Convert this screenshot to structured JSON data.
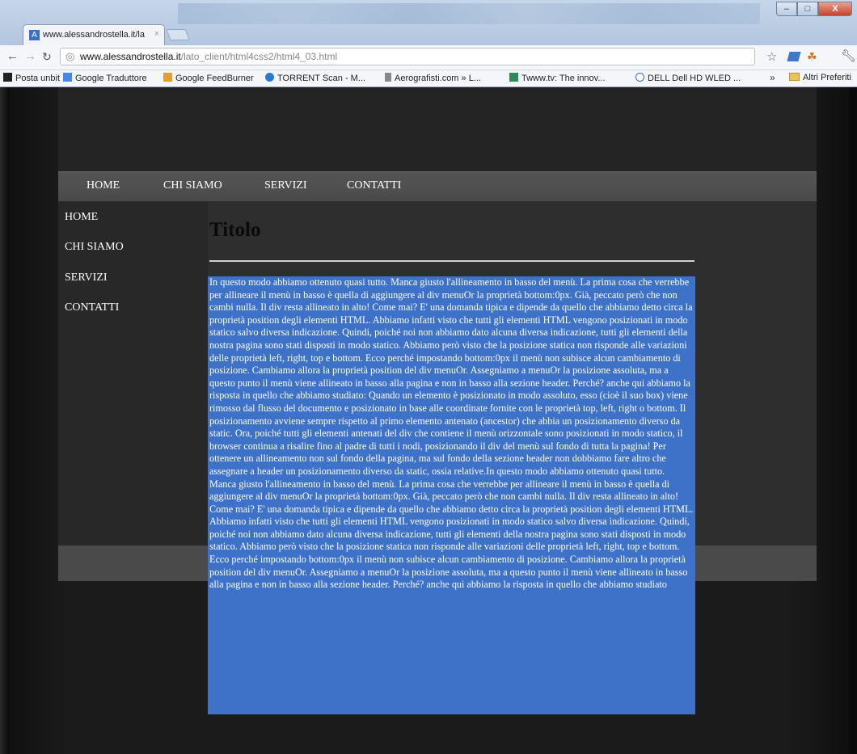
{
  "browser": {
    "tab_title": "www.alessandrostella.it/la",
    "tab_close": "×",
    "favicon_letter": "A",
    "url_host": "www.alessandrostella.it",
    "url_path": "/lato_client/html4css2/html4_03.html",
    "window_controls": {
      "minimize": "–",
      "maximize": "□",
      "close": "X"
    }
  },
  "bookmarks": [
    {
      "label": "Posta unbit",
      "icon": "square-icon",
      "color": "#222222"
    },
    {
      "label": "Google Traduttore",
      "icon": "translate-icon",
      "color": "#4a86e8"
    },
    {
      "label": "Google FeedBurner",
      "icon": "feedburner-icon",
      "color": "#e0a030"
    },
    {
      "label": "TORRENT Scan - M...",
      "icon": "torrent-icon",
      "color": "#2a7acc"
    },
    {
      "label": "Aerografisti.com » L...",
      "icon": "aero-icon",
      "color": "#888888"
    },
    {
      "label": "Twww.tv: The innov...",
      "icon": "tv-icon",
      "color": "#2f8a5a"
    },
    {
      "label": "DELL Dell HD WLED ...",
      "icon": "dell-icon",
      "color": "#3a6fc4"
    }
  ],
  "bookmarks_more": "»",
  "other_bookmarks": "Altri Preferiti",
  "site": {
    "menu": [
      "HOME",
      "CHI SIAMO",
      "SERVIZI",
      "CONTATTI"
    ],
    "sidebar": [
      "HOME",
      "CHI SIAMO",
      "SERVIZI",
      "CONTATTI"
    ],
    "title": "Titolo",
    "paragraph": "In questo modo abbiamo ottenuto quasi tutto. Manca giusto l'allineamento in basso del menù. La prima cosa che verrebbe per allineare il menù in basso è quella di aggiungere al div menuOr la proprietà bottom:0px. Già, peccato però che non cambi nulla. Il div resta allineato in alto! Come mai? E' una domanda tipica e dipende da quello che abbiamo detto circa la proprietà position degli elementi HTML. Abbiamo infatti visto che tutti gli elementi HTML vengono posizionati in modo statico salvo diversa indicazione. Quindi, poiché noi non abbiamo dato alcuna diversa indicazione, tutti gli elementi della nostra pagina sono stati disposti in modo statico. Abbiamo però visto che la posizione statica non risponde alle variazioni delle proprietà left, right, top e bottom. Ecco perché impostando bottom:0px il menù non subisce alcun cambiamento di posizione. Cambiamo allora la proprietà position del div menuOr. Assegniamo a menuOr la posizione assoluta, ma a questo punto il menù viene allineato in basso alla pagina e non in basso alla sezione header. Perché? anche qui abbiamo la risposta in quello che abbiamo studiato: Quando un elemento è posizionato in modo assoluto, esso (cioè il suo box) viene rimosso dal flusso del documento e posizionato in base alle coordinate fornite con le proprietà top, left, right o bottom. Il posizionamento avviene sempre rispetto al primo elemento antenato (ancestor) che abbia un posizionamento diverso da static. Ora, poiché tutti gli elementi antenati del div che contiene il menù orizzontale sono posizionati in modo statico, il browser continua a risalire fino al padre di tutti i nodi, posizionando il div del menù sul fondo di tutta la pagina! Per ottenere un allineamento non sul fondo della pagina, ma sul fondo della sezione header non dobbiamo fare altro che assegnare a header un posizionamento diverso da static, ossia relative.In questo modo abbiamo ottenuto quasi tutto. Manca giusto l'allineamento in basso del menù. La prima cosa che verrebbe per allineare il menù in basso è quella di aggiungere al div menuOr la proprietà bottom:0px. Già, peccato però che non cambi nulla. Il div resta allineato in alto! Come mai? E' una domanda tipica e dipende da quello che abbiamo detto circa la proprietà position degli elementi HTML. Abbiamo infatti visto che tutti gli elementi HTML vengono posizionati in modo statico salvo diversa indicazione. Quindi, poiché noi non abbiamo dato alcuna diversa indicazione, tutti gli elementi della nostra pagina sono stati disposti in modo statico. Abbiamo però visto che la posizione statica non risponde alle variazioni delle proprietà left, right, top e bottom. Ecco perché impostando bottom:0px il menù non subisce alcun cambiamento di posizione. Cambiamo allora la proprietà position del div menuOr. Assegniamo a menuOr la posizione assoluta, ma a questo punto il menù viene allineato in basso alla pagina e non in basso alla sezione header. Perché? anche qui abbiamo la risposta in quello che abbiamo studiato"
  },
  "colors": {
    "selection": "#3d72c8",
    "menu_bar": "#4f4f4f",
    "header": "#242424",
    "sidebar": "#282828"
  }
}
